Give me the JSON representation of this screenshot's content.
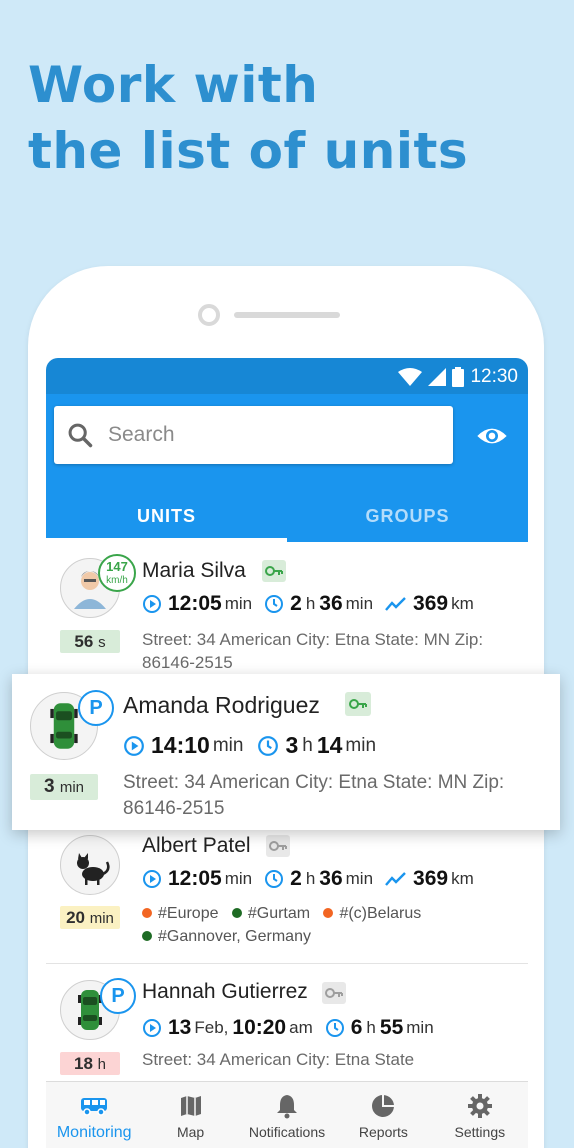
{
  "headline": {
    "line1": "Work with",
    "line2": "the list of units"
  },
  "status_bar": {
    "time": "12:30"
  },
  "search": {
    "placeholder": "Search"
  },
  "tabs": [
    {
      "label": "UNITS",
      "active": true
    },
    {
      "label": "GROUPS",
      "active": false
    }
  ],
  "units": [
    {
      "name": "Maria Silva",
      "avatar_icon": "person-icon",
      "speed_value": "147",
      "speed_unit": "km/h",
      "time_chip_value": "56",
      "time_chip_unit": "s",
      "time_chip_color": "#d8ecd9",
      "key_color": "#3aa54a",
      "last_msg_time": "12:05",
      "last_msg_unit": "min",
      "duration_h": "2",
      "duration_h_unit": "h",
      "duration_m": "36",
      "duration_m_unit": "min",
      "mileage": "369",
      "mileage_unit": "km",
      "address_line1": "Street: 34 American City: Etna State: MN Zip:",
      "address_line2": "86146-2515"
    },
    {
      "name": "Amanda Rodriguez",
      "avatar_icon": "green-car-icon",
      "badge": "P",
      "time_chip_value": "3",
      "time_chip_unit": "min",
      "time_chip_color": "#d8ecd9",
      "key_color": "#3aa54a",
      "last_msg_time": "14:10",
      "last_msg_unit": "min",
      "duration_h": "3",
      "duration_h_unit": "h",
      "duration_m": "14",
      "duration_m_unit": "min",
      "address_line1": "Street: 34 American City: Etna State: MN Zip:",
      "address_line2": "86146-2515"
    },
    {
      "name": "Albert Patel",
      "avatar_icon": "cat-icon",
      "time_chip_value": "20",
      "time_chip_unit": "min",
      "time_chip_color": "#fbf1c2",
      "key_color": "#9e9e9e",
      "last_msg_time": "12:05",
      "last_msg_unit": "min",
      "duration_h": "2",
      "duration_h_unit": "h",
      "duration_m": "36",
      "duration_m_unit": "min",
      "mileage": "369",
      "mileage_unit": "km",
      "tags": [
        {
          "label": "#Europe",
          "color": "#f26522"
        },
        {
          "label": "#Gurtam",
          "color": "#1e6b24"
        },
        {
          "label": "#(c)Belarus",
          "color": "#f26522"
        },
        {
          "label": "#Gannover, Germany",
          "color": "#1e6b24"
        }
      ]
    },
    {
      "name": "Hannah Gutierrez",
      "avatar_icon": "green-car-icon",
      "badge": "P",
      "time_chip_value": "18",
      "time_chip_unit": "h",
      "time_chip_color": "#fcd4d4",
      "key_color": "#9e9e9e",
      "last_msg_day": "13",
      "last_msg_month": "Feb,",
      "last_msg_time": "10:20",
      "last_msg_unit": "am",
      "duration_h": "6",
      "duration_h_unit": "h",
      "duration_m": "55",
      "duration_m_unit": "min",
      "address_line1": "Street: 34 American City: Etna State"
    }
  ],
  "bottom_nav": [
    {
      "label": "Monitoring",
      "icon": "truck-icon",
      "active": true
    },
    {
      "label": "Map",
      "icon": "map-icon",
      "active": false
    },
    {
      "label": "Notifications",
      "icon": "bell-icon",
      "active": false
    },
    {
      "label": "Reports",
      "icon": "pie-chart-icon",
      "active": false
    },
    {
      "label": "Settings",
      "icon": "gear-icon",
      "active": false
    }
  ],
  "colors": {
    "accent": "#1a95ee",
    "headline": "#2d8fcf",
    "background": "#cfe9f8"
  }
}
